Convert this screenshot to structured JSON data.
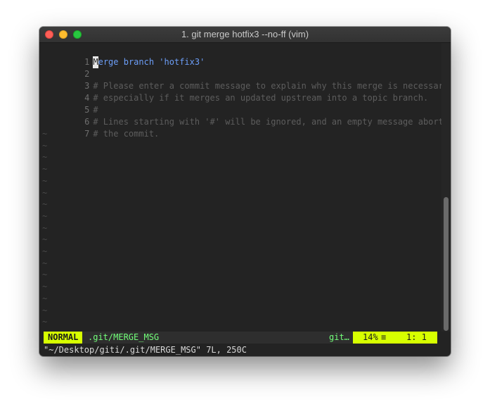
{
  "window": {
    "title": "1. git merge hotfix3 --no-ff (vim)"
  },
  "editor": {
    "lines": [
      {
        "num": "1",
        "cursor_char": "M",
        "text": "erge branch 'hotfix3'",
        "kind": "subject"
      },
      {
        "num": "2",
        "text": "",
        "kind": "blank"
      },
      {
        "num": "3",
        "text": "# Please enter a commit message to explain why this merge is necessary,",
        "kind": "comment"
      },
      {
        "num": "4",
        "text": "# especially if it merges an updated upstream into a topic branch.",
        "kind": "comment"
      },
      {
        "num": "5",
        "text": "#",
        "kind": "comment"
      },
      {
        "num": "6",
        "text": "# Lines starting with '#' will be ignored, and an empty message aborts",
        "kind": "comment"
      },
      {
        "num": "7",
        "text": "# the commit.",
        "kind": "comment"
      }
    ],
    "empty_marker": "~",
    "empty_line_count": 17
  },
  "statusline": {
    "mode": "NORMAL",
    "file": ".git/MERGE_MSG",
    "branch": "git…",
    "percent": "14%",
    "menu_icon": "≡",
    "line_col": "1:  1"
  },
  "cmdline": {
    "message": "\"~/Desktop/giti/.git/MERGE_MSG\" 7L, 250C"
  },
  "colors": {
    "background": "#232323",
    "mode_bg": "#d7ff00",
    "filename": "#73ff7a",
    "subject": "#6c9ef8",
    "comment": "#5d5d5d"
  }
}
